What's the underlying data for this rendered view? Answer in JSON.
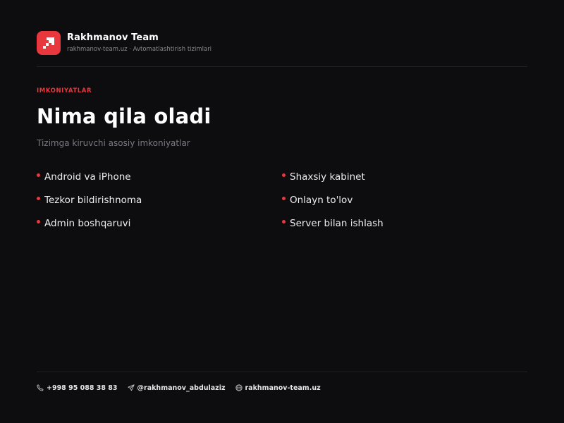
{
  "header": {
    "logo_icon": "arrow-up-right-pixel-icon",
    "brand_name": "Rakhmanov Team",
    "brand_subtitle": "rakhmanov-team.uz · Avtomatlashtirish tizimlari"
  },
  "main": {
    "eyebrow": "IMKONIYATLAR",
    "title": "Nima qila oladi",
    "subtitle": "Tizimga kiruvchi asosiy imkoniyatlar",
    "features": [
      "Android va iPhone",
      "Shaxsiy kabinet",
      "Tezkor bildirishnoma",
      "Onlayn to'lov",
      "Admin boshqaruvi",
      "Server bilan ishlash"
    ]
  },
  "footer": {
    "phone_icon": "phone-icon",
    "phone": "+998 95 088 38 83",
    "telegram_icon": "telegram-icon",
    "telegram": "@rakhmanov_abdulaziz",
    "website_icon": "globe-icon",
    "website": "rakhmanov-team.uz"
  },
  "colors": {
    "background": "#0d0d0f",
    "accent": "#e8383d",
    "text_primary": "#ffffff",
    "text_secondary": "#7a7a82"
  }
}
